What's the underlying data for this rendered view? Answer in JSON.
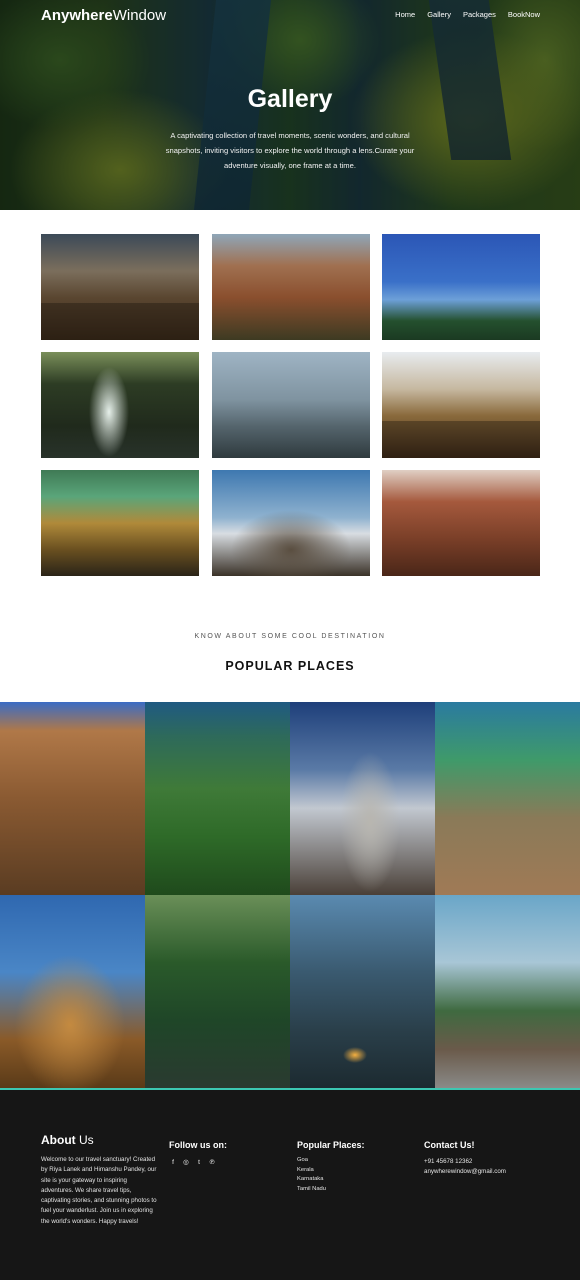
{
  "header": {
    "brand_bold": "Anywhere",
    "brand_rest": "Window",
    "nav": [
      "Home",
      "Gallery",
      "Packages",
      "BookNow"
    ]
  },
  "hero": {
    "title": "Gallery",
    "description": "A captivating collection of travel moments, scenic wonders, and cultural snapshots, inviting visitors to explore the world through a lens.Curate your adventure visually, one frame at a time."
  },
  "gallery": {
    "images": [
      "heritage-ruins",
      "rock-formation-temple",
      "palm-beach",
      "waterfall",
      "misty-hills-birds",
      "temple-ruins",
      "palace-hall",
      "temple-gopuram",
      "stepwell"
    ]
  },
  "popular": {
    "kicker": "KNOW ABOUT SOME COOL DESTINATION",
    "title": "POPULAR PLACES",
    "images": [
      "mysore-palace",
      "green-ridge",
      "hampi-gopuram",
      "coastal-beach",
      "brihadeeswarar-temple",
      "backwater-boat",
      "foggy-forest-road",
      "coastal-fort"
    ]
  },
  "footer": {
    "about_bold": "About",
    "about_rest": " Us",
    "about_text": "Welcome to our travel sanctuary! Created by Riya Lanek and Himanshu Pandey, our site is your gateway to inspiring adventures. We share travel tips, captivating stories, and stunning photos to fuel your wanderlust. Join us in exploring the world's wonders. Happy travels!",
    "follow_title": "Follow us on:",
    "social": [
      "f",
      "◎",
      "t",
      "℗"
    ],
    "places_title": "Popular Places:",
    "places": [
      "Goa",
      "Kerala",
      "Karnataka",
      "Tamil Nadu"
    ],
    "contact_title": "Contact Us!",
    "phone": "+91 45678 12362",
    "email": "anywherewindow@gmail.com"
  },
  "colors": {
    "footer_bg": "#161616",
    "footer_accent": "#3cc7b2"
  }
}
